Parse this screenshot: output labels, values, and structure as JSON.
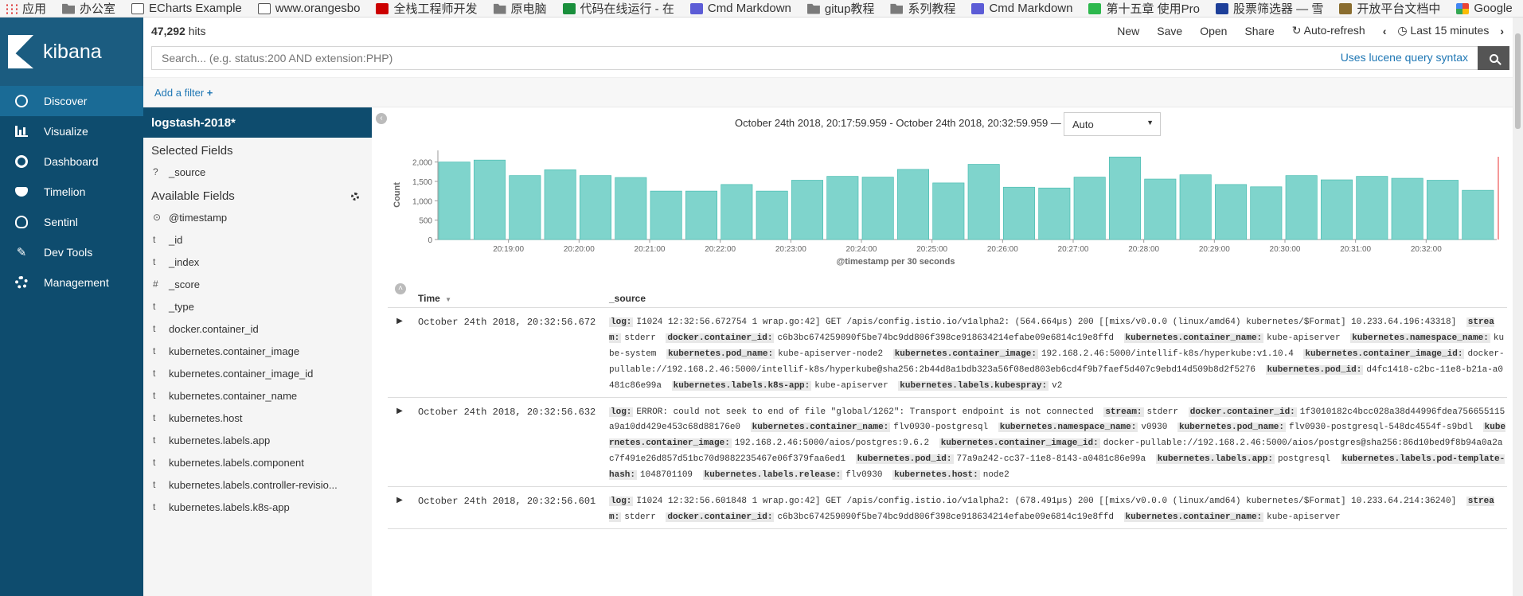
{
  "bookmarks": [
    {
      "label": "应用",
      "icon": "apps-icon"
    },
    {
      "label": "办公室",
      "icon": "folder-icon"
    },
    {
      "label": "ECharts Example",
      "icon": "page-icon"
    },
    {
      "label": "www.orangesbo",
      "icon": "page-icon"
    },
    {
      "label": "全栈工程师开发",
      "icon": "csdn-icon"
    },
    {
      "label": "原电脑",
      "icon": "folder-icon"
    },
    {
      "label": "代码在线运行 - 在",
      "icon": "code-icon"
    },
    {
      "label": "Cmd Markdown",
      "icon": "cmd-icon"
    },
    {
      "label": "gitup教程",
      "icon": "folder-icon"
    },
    {
      "label": "系列教程",
      "icon": "folder-icon"
    },
    {
      "label": "Cmd Markdown",
      "icon": "cmd-icon"
    },
    {
      "label": "第十五章 使用Pro",
      "icon": "wechat-icon"
    },
    {
      "label": "股票筛选器 — 雪",
      "icon": "stock-icon"
    },
    {
      "label": "开放平台文档中",
      "icon": "fly-icon"
    },
    {
      "label": "Google",
      "icon": "google-icon"
    }
  ],
  "brand": {
    "name": "kibana"
  },
  "nav": [
    {
      "label": "Discover",
      "icon": "compass-icon",
      "active": true
    },
    {
      "label": "Visualize",
      "icon": "bar-chart-icon",
      "active": false
    },
    {
      "label": "Dashboard",
      "icon": "dashboard-icon",
      "active": false
    },
    {
      "label": "Timelion",
      "icon": "mask-icon",
      "active": false
    },
    {
      "label": "Sentinl",
      "icon": "alarm-icon",
      "active": false
    },
    {
      "label": "Dev Tools",
      "icon": "wrench-icon",
      "active": false
    },
    {
      "label": "Management",
      "icon": "gear-icon",
      "active": false
    }
  ],
  "top": {
    "hits_count": "47,292",
    "hits_label": "hits",
    "actions": {
      "new": "New",
      "save": "Save",
      "open": "Open",
      "share": "Share",
      "auto_refresh": "Auto-refresh",
      "time_picker": "Last 15 minutes"
    }
  },
  "search": {
    "placeholder": "Search... (e.g. status:200 AND extension:PHP)",
    "lucene_link": "Uses lucene query syntax"
  },
  "filter": {
    "add_label": "Add a filter"
  },
  "fields_panel": {
    "index_pattern": "logstash-2018*",
    "selected_heading": "Selected Fields",
    "selected": [
      {
        "type": "?",
        "name": "_source"
      }
    ],
    "available_heading": "Available Fields",
    "available": [
      {
        "type": "⊙",
        "name": "@timestamp"
      },
      {
        "type": "t",
        "name": "_id"
      },
      {
        "type": "t",
        "name": "_index"
      },
      {
        "type": "#",
        "name": "_score"
      },
      {
        "type": "t",
        "name": "_type"
      },
      {
        "type": "t",
        "name": "docker.container_id"
      },
      {
        "type": "t",
        "name": "kubernetes.container_image"
      },
      {
        "type": "t",
        "name": "kubernetes.container_image_id"
      },
      {
        "type": "t",
        "name": "kubernetes.container_name"
      },
      {
        "type": "t",
        "name": "kubernetes.host"
      },
      {
        "type": "t",
        "name": "kubernetes.labels.app"
      },
      {
        "type": "t",
        "name": "kubernetes.labels.component"
      },
      {
        "type": "t",
        "name": "kubernetes.labels.controller-revisio..."
      },
      {
        "type": "t",
        "name": "kubernetes.labels.k8s-app"
      }
    ]
  },
  "histogram": {
    "time_range": "October 24th 2018, 20:17:59.959 - October 24th 2018, 20:32:59.959 —",
    "interval": "Auto"
  },
  "chart_data": {
    "type": "bar",
    "title": "",
    "xlabel": "@timestamp per 30 seconds",
    "ylabel": "Count",
    "ylim": [
      0,
      2300
    ],
    "yticks": [
      0,
      500,
      1000,
      1500,
      2000
    ],
    "yticklabels": [
      "0",
      "500",
      "1,000",
      "1,500",
      "2,000"
    ],
    "xticklabels": [
      "20:19:00",
      "20:20:00",
      "20:21:00",
      "20:22:00",
      "20:23:00",
      "20:24:00",
      "20:25:00",
      "20:26:00",
      "20:27:00",
      "20:28:00",
      "20:29:00",
      "20:30:00",
      "20:31:00",
      "20:32:00"
    ],
    "categories": [
      "20:18:00",
      "20:18:30",
      "20:19:00",
      "20:19:30",
      "20:20:00",
      "20:20:30",
      "20:21:00",
      "20:21:30",
      "20:22:00",
      "20:22:30",
      "20:23:00",
      "20:23:30",
      "20:24:00",
      "20:24:30",
      "20:25:00",
      "20:25:30",
      "20:26:00",
      "20:26:30",
      "20:27:00",
      "20:27:30",
      "20:28:00",
      "20:28:30",
      "20:29:00",
      "20:29:30",
      "20:30:00",
      "20:30:30",
      "20:31:00",
      "20:31:30",
      "20:32:00",
      "20:32:30"
    ],
    "values": [
      2000,
      2050,
      1650,
      1800,
      1650,
      1600,
      1250,
      1250,
      1420,
      1250,
      1530,
      1630,
      1610,
      1810,
      1460,
      1940,
      1350,
      1330,
      1610,
      2130,
      1560,
      1670,
      1420,
      1360,
      1650,
      1540,
      1630,
      1580,
      1530,
      1270
    ],
    "color": "#7fd4cc"
  },
  "doc_table": {
    "time_header": "Time",
    "source_header": "_source",
    "rows": [
      {
        "time": "October 24th 2018, 20:32:56.672",
        "fields": [
          [
            "log:",
            "I1024 12:32:56.672754 1 wrap.go:42] GET /apis/config.istio.io/v1alpha2: (564.664µs) 200 [[mixs/v0.0.0 (linux/amd64) kubernetes/$Format] 10.233.64.196:43318]"
          ],
          [
            "stream:",
            "stderr"
          ],
          [
            "docker.container_id:",
            "c6b3bc674259090f5be74bc9dd806f398ce918634214efabe09e6814c19e8ffd"
          ],
          [
            "kubernetes.container_name:",
            "kube-apiserver"
          ],
          [
            "kubernetes.namespace_name:",
            "kube-system"
          ],
          [
            "kubernetes.pod_name:",
            "kube-apiserver-node2"
          ],
          [
            "kubernetes.container_image:",
            "192.168.2.46:5000/intellif-k8s/hyperkube:v1.10.4"
          ],
          [
            "kubernetes.container_image_id:",
            "docker-pullable://192.168.2.46:5000/intellif-k8s/hyperkube@sha256:2b44d8a1bdb323a56f08ed803eb6cd4f9b7faef5d407c9ebd14d509b8d2f5276"
          ],
          [
            "kubernetes.pod_id:",
            "d4fc1418-c2bc-11e8-b21a-a0481c86e99a"
          ],
          [
            "kubernetes.labels.k8s-app:",
            "kube-apiserver"
          ],
          [
            "kubernetes.labels.kubespray:",
            "v2"
          ]
        ]
      },
      {
        "time": "October 24th 2018, 20:32:56.632",
        "fields": [
          [
            "log:",
            "ERROR: could not seek to end of file \"global/1262\": Transport endpoint is not connected"
          ],
          [
            "stream:",
            "stderr"
          ],
          [
            "docker.container_id:",
            "1f3010182c4bcc028a38d44996fdea756655115a9a10dd429e453c68d88176e0"
          ],
          [
            "kubernetes.container_name:",
            "flv0930-postgresql"
          ],
          [
            "kubernetes.namespace_name:",
            "v0930"
          ],
          [
            "kubernetes.pod_name:",
            "flv0930-postgresql-548dc4554f-s9bdl"
          ],
          [
            "kubernetes.container_image:",
            "192.168.2.46:5000/aios/postgres:9.6.2"
          ],
          [
            "kubernetes.container_image_id:",
            "docker-pullable://192.168.2.46:5000/aios/postgres@sha256:86d10bed9f8b94a0a2ac7f491e26d857d51bc70d9882235467e06f379faa6ed1"
          ],
          [
            "kubernetes.pod_id:",
            "77a9a242-cc37-11e8-8143-a0481c86e99a"
          ],
          [
            "kubernetes.labels.app:",
            "postgresql"
          ],
          [
            "kubernetes.labels.pod-template-hash:",
            "1048701109"
          ],
          [
            "kubernetes.labels.release:",
            "flv0930"
          ],
          [
            "kubernetes.host:",
            "node2"
          ]
        ]
      },
      {
        "time": "October 24th 2018, 20:32:56.601",
        "fields": [
          [
            "log:",
            "I1024 12:32:56.601848 1 wrap.go:42] GET /apis/config.istio.io/v1alpha2: (678.491µs) 200 [[mixs/v0.0.0 (linux/amd64) kubernetes/$Format] 10.233.64.214:36240]"
          ],
          [
            "stream:",
            "stderr"
          ],
          [
            "docker.container_id:",
            "c6b3bc674259090f5be74bc9dd806f398ce918634214efabe09e6814c19e8ffd"
          ],
          [
            "kubernetes.container_name:",
            "kube-apiserver"
          ]
        ]
      }
    ]
  }
}
